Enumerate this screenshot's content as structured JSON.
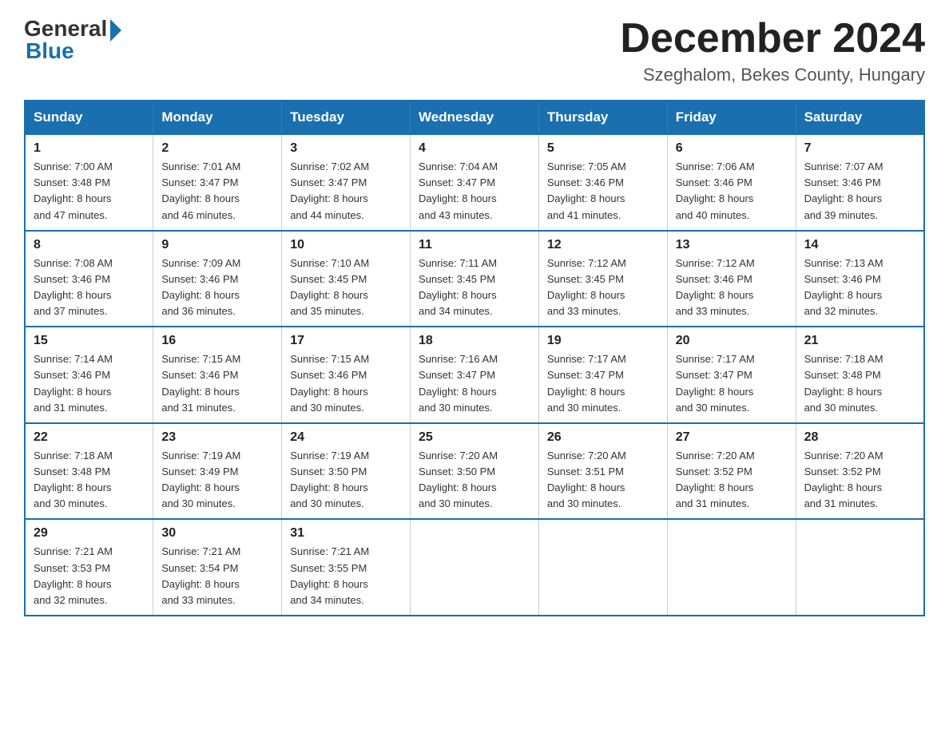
{
  "header": {
    "logo_general": "General",
    "logo_blue": "Blue",
    "month_title": "December 2024",
    "location": "Szeghalom, Bekes County, Hungary"
  },
  "columns": [
    "Sunday",
    "Monday",
    "Tuesday",
    "Wednesday",
    "Thursday",
    "Friday",
    "Saturday"
  ],
  "weeks": [
    [
      {
        "day": "1",
        "sunrise": "7:00 AM",
        "sunset": "3:48 PM",
        "daylight": "8 hours and 47 minutes."
      },
      {
        "day": "2",
        "sunrise": "7:01 AM",
        "sunset": "3:47 PM",
        "daylight": "8 hours and 46 minutes."
      },
      {
        "day": "3",
        "sunrise": "7:02 AM",
        "sunset": "3:47 PM",
        "daylight": "8 hours and 44 minutes."
      },
      {
        "day": "4",
        "sunrise": "7:04 AM",
        "sunset": "3:47 PM",
        "daylight": "8 hours and 43 minutes."
      },
      {
        "day": "5",
        "sunrise": "7:05 AM",
        "sunset": "3:46 PM",
        "daylight": "8 hours and 41 minutes."
      },
      {
        "day": "6",
        "sunrise": "7:06 AM",
        "sunset": "3:46 PM",
        "daylight": "8 hours and 40 minutes."
      },
      {
        "day": "7",
        "sunrise": "7:07 AM",
        "sunset": "3:46 PM",
        "daylight": "8 hours and 39 minutes."
      }
    ],
    [
      {
        "day": "8",
        "sunrise": "7:08 AM",
        "sunset": "3:46 PM",
        "daylight": "8 hours and 37 minutes."
      },
      {
        "day": "9",
        "sunrise": "7:09 AM",
        "sunset": "3:46 PM",
        "daylight": "8 hours and 36 minutes."
      },
      {
        "day": "10",
        "sunrise": "7:10 AM",
        "sunset": "3:45 PM",
        "daylight": "8 hours and 35 minutes."
      },
      {
        "day": "11",
        "sunrise": "7:11 AM",
        "sunset": "3:45 PM",
        "daylight": "8 hours and 34 minutes."
      },
      {
        "day": "12",
        "sunrise": "7:12 AM",
        "sunset": "3:45 PM",
        "daylight": "8 hours and 33 minutes."
      },
      {
        "day": "13",
        "sunrise": "7:12 AM",
        "sunset": "3:46 PM",
        "daylight": "8 hours and 33 minutes."
      },
      {
        "day": "14",
        "sunrise": "7:13 AM",
        "sunset": "3:46 PM",
        "daylight": "8 hours and 32 minutes."
      }
    ],
    [
      {
        "day": "15",
        "sunrise": "7:14 AM",
        "sunset": "3:46 PM",
        "daylight": "8 hours and 31 minutes."
      },
      {
        "day": "16",
        "sunrise": "7:15 AM",
        "sunset": "3:46 PM",
        "daylight": "8 hours and 31 minutes."
      },
      {
        "day": "17",
        "sunrise": "7:15 AM",
        "sunset": "3:46 PM",
        "daylight": "8 hours and 30 minutes."
      },
      {
        "day": "18",
        "sunrise": "7:16 AM",
        "sunset": "3:47 PM",
        "daylight": "8 hours and 30 minutes."
      },
      {
        "day": "19",
        "sunrise": "7:17 AM",
        "sunset": "3:47 PM",
        "daylight": "8 hours and 30 minutes."
      },
      {
        "day": "20",
        "sunrise": "7:17 AM",
        "sunset": "3:47 PM",
        "daylight": "8 hours and 30 minutes."
      },
      {
        "day": "21",
        "sunrise": "7:18 AM",
        "sunset": "3:48 PM",
        "daylight": "8 hours and 30 minutes."
      }
    ],
    [
      {
        "day": "22",
        "sunrise": "7:18 AM",
        "sunset": "3:48 PM",
        "daylight": "8 hours and 30 minutes."
      },
      {
        "day": "23",
        "sunrise": "7:19 AM",
        "sunset": "3:49 PM",
        "daylight": "8 hours and 30 minutes."
      },
      {
        "day": "24",
        "sunrise": "7:19 AM",
        "sunset": "3:50 PM",
        "daylight": "8 hours and 30 minutes."
      },
      {
        "day": "25",
        "sunrise": "7:20 AM",
        "sunset": "3:50 PM",
        "daylight": "8 hours and 30 minutes."
      },
      {
        "day": "26",
        "sunrise": "7:20 AM",
        "sunset": "3:51 PM",
        "daylight": "8 hours and 30 minutes."
      },
      {
        "day": "27",
        "sunrise": "7:20 AM",
        "sunset": "3:52 PM",
        "daylight": "8 hours and 31 minutes."
      },
      {
        "day": "28",
        "sunrise": "7:20 AM",
        "sunset": "3:52 PM",
        "daylight": "8 hours and 31 minutes."
      }
    ],
    [
      {
        "day": "29",
        "sunrise": "7:21 AM",
        "sunset": "3:53 PM",
        "daylight": "8 hours and 32 minutes."
      },
      {
        "day": "30",
        "sunrise": "7:21 AM",
        "sunset": "3:54 PM",
        "daylight": "8 hours and 33 minutes."
      },
      {
        "day": "31",
        "sunrise": "7:21 AM",
        "sunset": "3:55 PM",
        "daylight": "8 hours and 34 minutes."
      },
      null,
      null,
      null,
      null
    ]
  ],
  "sunrise_label": "Sunrise:",
  "sunset_label": "Sunset:",
  "daylight_label": "Daylight:"
}
